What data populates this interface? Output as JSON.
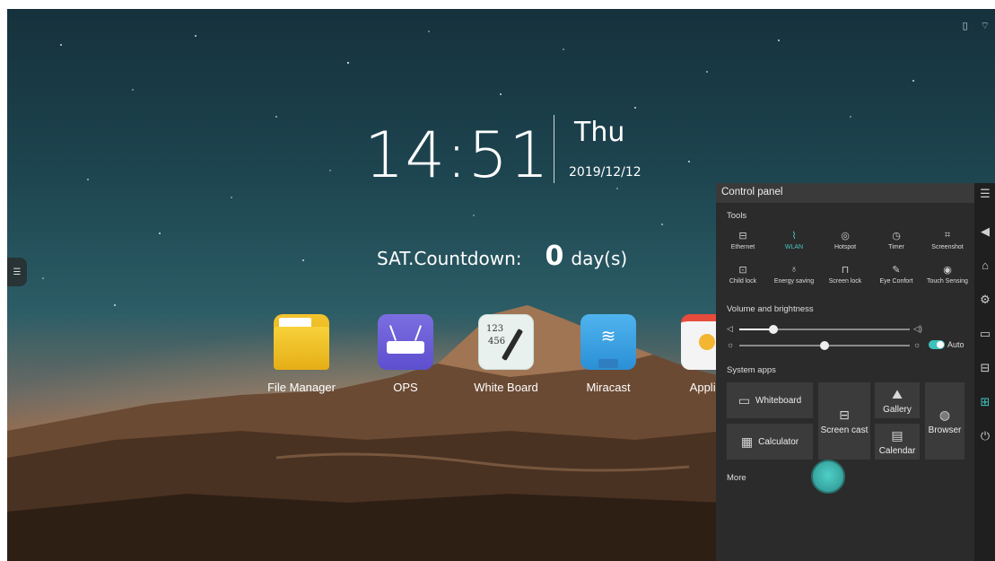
{
  "status_icons": [
    "usb-icon",
    "wifi-off-icon"
  ],
  "clock": {
    "time": "14:51",
    "weekday": "Thu",
    "date": "2019/12/12"
  },
  "countdown": {
    "label": "SAT.Countdown:",
    "value": "0",
    "unit": "day(s)"
  },
  "apps": [
    {
      "label": "File Manager",
      "icon": "folder-icon"
    },
    {
      "label": "OPS",
      "icon": "router-icon"
    },
    {
      "label": "White Board",
      "icon": "whiteboard-icon"
    },
    {
      "label": "Miracast",
      "icon": "miracast-icon"
    },
    {
      "label": "Applica",
      "icon": "applications-icon"
    }
  ],
  "control_panel": {
    "title": "Control panel",
    "tools_heading": "Tools",
    "tools": [
      {
        "label": "Ethernet",
        "icon": "ethernet-icon",
        "active": false
      },
      {
        "label": "WLAN",
        "icon": "wlan-icon",
        "active": true
      },
      {
        "label": "Hotspot",
        "icon": "hotspot-icon",
        "active": false
      },
      {
        "label": "Timer",
        "icon": "timer-icon",
        "active": false
      },
      {
        "label": "Screenshot",
        "icon": "screenshot-icon",
        "active": false
      },
      {
        "label": "Child lock",
        "icon": "child-lock-icon",
        "active": false
      },
      {
        "label": "Energy saving",
        "icon": "energy-saving-icon",
        "active": false
      },
      {
        "label": "Screen lock",
        "icon": "screen-lock-icon",
        "active": false
      },
      {
        "label": "Eye Confort",
        "icon": "eye-comfort-icon",
        "active": false
      },
      {
        "label": "Touch Sensing",
        "icon": "touch-sensing-icon",
        "active": false
      }
    ],
    "volume_heading": "Volume and brightness",
    "volume_level": 0.2,
    "brightness_level": 0.5,
    "auto_label": "Auto",
    "auto_on": true,
    "system_heading": "System apps",
    "system_apps": {
      "whiteboard": "Whiteboard",
      "calculator": "Calculator",
      "screen_cast": "Screen cast",
      "gallery": "Gallery",
      "calendar": "Calendar",
      "browser": "Browser"
    },
    "more_label": "More"
  },
  "accent_color": "#45c7c2"
}
